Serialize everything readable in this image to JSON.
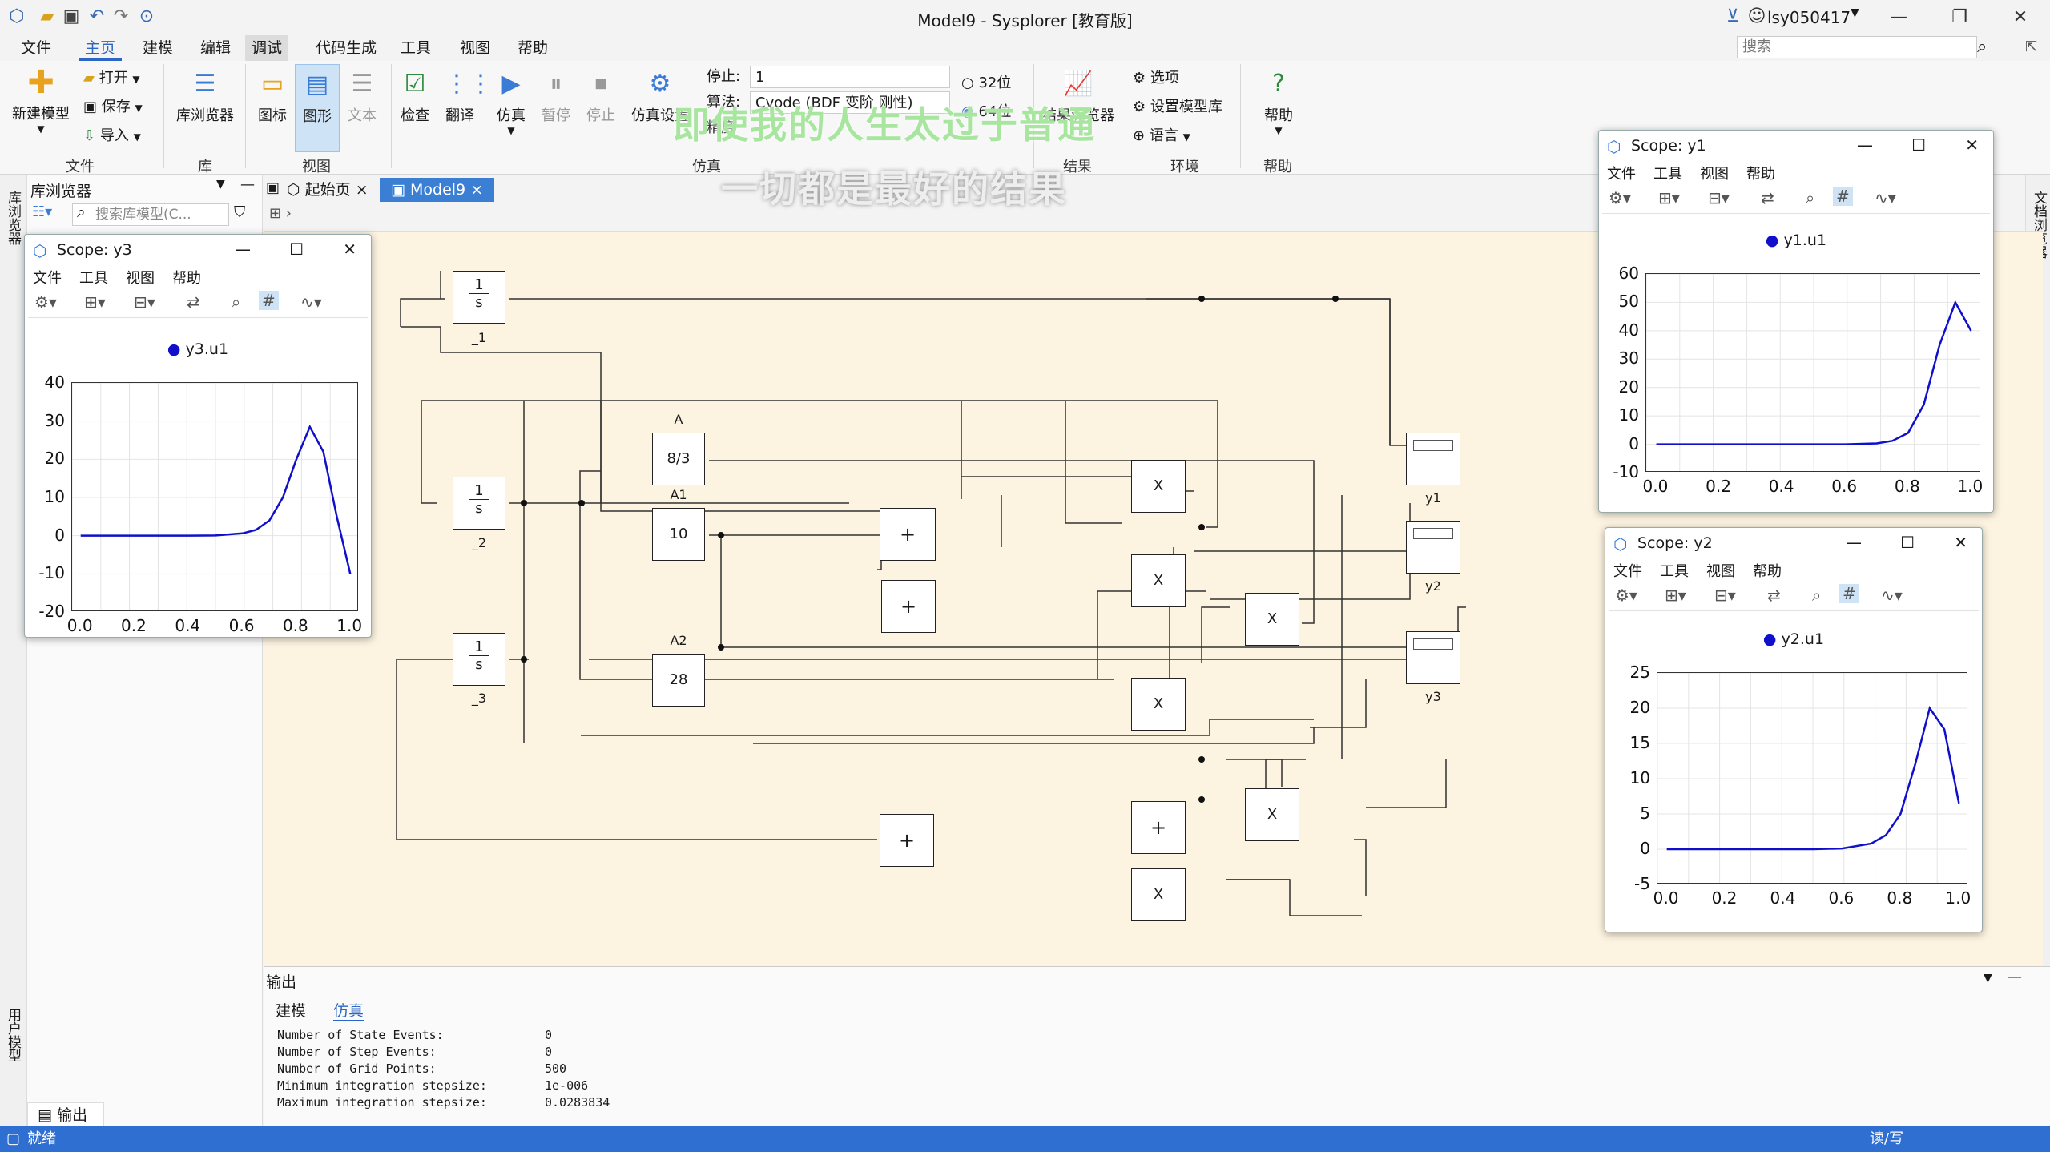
{
  "window": {
    "title": "Model9 - Sysplorer [教育版]",
    "user": "lsy050417",
    "search_placeholder": "搜索"
  },
  "menubar": [
    "文件",
    "主页",
    "建模",
    "编辑",
    "调试",
    "代码生成",
    "工具",
    "视图",
    "帮助"
  ],
  "ribbon": {
    "new_model": "新建模型",
    "open": "打开",
    "save": "保存",
    "import": "导入",
    "lib_browser": "库浏览器",
    "icon": "图标",
    "graphic": "图形",
    "text": "文本",
    "check": "检查",
    "translate": "翻译",
    "simulate": "仿真",
    "pause": "暂停",
    "stop": "停止",
    "sim_settings": "仿真设置",
    "stop_label": "停止:",
    "stop_value": "1",
    "algo_label": "算法:",
    "algo_value": "Cvode (BDF 变阶 刚性)",
    "precision_label": "精度",
    "bits32": "32位",
    "bits64": "64位",
    "result_browser": "结果浏览器",
    "options": "选项",
    "set_model_lib": "设置模型库",
    "language": "语言",
    "help": "帮助",
    "groups": {
      "file": "文件",
      "lib": "库",
      "view": "视图",
      "sim": "仿真",
      "result": "结果",
      "env": "环境",
      "help": "帮助"
    }
  },
  "left": {
    "strip_top": "库浏览器",
    "strip_bottom": "用户模型",
    "panel_title": "库浏览器",
    "search_placeholder": "搜索库模型(C..."
  },
  "right_strip": "文档浏览器",
  "doc_tabs": [
    "起始页",
    "Model9"
  ],
  "blocks": {
    "int1": {
      "num": "1",
      "den": "s",
      "label": "_1"
    },
    "int2": {
      "num": "1",
      "den": "s",
      "label": "_2"
    },
    "int3": {
      "num": "1",
      "den": "s",
      "label": "_3"
    },
    "constA": {
      "value": "8/3",
      "label": "A"
    },
    "constA1": {
      "value": "10",
      "label": "A1"
    },
    "constA2": {
      "value": "28",
      "label": "A2"
    },
    "add_sym": "+",
    "mul_sym": "X",
    "out_y1": "y1",
    "out_y2": "y2",
    "out_y3": "y3"
  },
  "output": {
    "title": "输出",
    "tabs": [
      "建模",
      "仿真"
    ],
    "lines": [
      {
        "k": "Number of State Events:",
        "v": "0"
      },
      {
        "k": "Number of Step Events:",
        "v": "0"
      },
      {
        "k": "Number of Grid Points:",
        "v": "500"
      },
      {
        "k": "Minimum integration stepsize:",
        "v": "1e-006"
      },
      {
        "k": "Maximum integration stepsize:",
        "v": "0.0283834"
      }
    ],
    "bottom_tab": "输出"
  },
  "status": {
    "left": "就绪",
    "right": "读/写"
  },
  "overlay": {
    "line1": "即使我的人生太过于普通",
    "line2": "一切都是最好的结果"
  },
  "scope_menu": [
    "文件",
    "工具",
    "视图",
    "帮助"
  ],
  "scopes": [
    {
      "title": "Scope: y3",
      "legend": "y3.u1",
      "chart_data": {
        "type": "line",
        "x": [
          0.0,
          0.1,
          0.2,
          0.3,
          0.4,
          0.5,
          0.6,
          0.65,
          0.7,
          0.75,
          0.8,
          0.85,
          0.9,
          0.95,
          1.0
        ],
        "series": [
          {
            "name": "y3.u1",
            "values": [
              0,
              0,
              0,
              0,
              0,
              0.05,
              0.6,
              1.5,
              4,
              10,
              20,
              28.5,
              22,
              5,
              -10
            ]
          }
        ],
        "ylim": [
          -20,
          40
        ],
        "yticks": [
          "40",
          "30",
          "20",
          "10",
          "0",
          "-10",
          "-20"
        ],
        "xticks": [
          "0.0",
          "0.2",
          "0.4",
          "0.6",
          "0.8",
          "1.0"
        ],
        "grid": true,
        "color": "#1010cc"
      }
    },
    {
      "title": "Scope: y1",
      "legend": "y1.u1",
      "chart_data": {
        "type": "line",
        "x": [
          0.0,
          0.1,
          0.2,
          0.3,
          0.4,
          0.5,
          0.6,
          0.7,
          0.75,
          0.8,
          0.85,
          0.9,
          0.95,
          1.0
        ],
        "series": [
          {
            "name": "y1.u1",
            "values": [
              0,
              0,
              0,
              0,
              0,
              0,
              0,
              0.3,
              1.2,
              4,
              14,
              35,
              50,
              40
            ]
          }
        ],
        "ylim": [
          -10,
          60
        ],
        "yticks": [
          "60",
          "50",
          "40",
          "30",
          "20",
          "10",
          "0",
          "-10"
        ],
        "xticks": [
          "0.0",
          "0.2",
          "0.4",
          "0.6",
          "0.8",
          "1.0"
        ],
        "grid": true,
        "color": "#1010cc"
      }
    },
    {
      "title": "Scope: y2",
      "legend": "y2.u1",
      "chart_data": {
        "type": "line",
        "x": [
          0.0,
          0.1,
          0.2,
          0.3,
          0.4,
          0.5,
          0.6,
          0.7,
          0.75,
          0.8,
          0.85,
          0.9,
          0.95,
          1.0
        ],
        "series": [
          {
            "name": "y2.u1",
            "values": [
              0,
              0,
              0,
              0,
              0,
              0,
              0.1,
              0.8,
              2,
              5,
              12,
              20,
              17,
              6.5
            ]
          }
        ],
        "ylim": [
          -5,
          25
        ],
        "yticks": [
          "25",
          "20",
          "15",
          "10",
          "5",
          "0",
          "-5"
        ],
        "xticks": [
          "0.0",
          "0.2",
          "0.4",
          "0.6",
          "0.8",
          "1.0"
        ],
        "grid": true,
        "color": "#1010cc"
      }
    }
  ]
}
